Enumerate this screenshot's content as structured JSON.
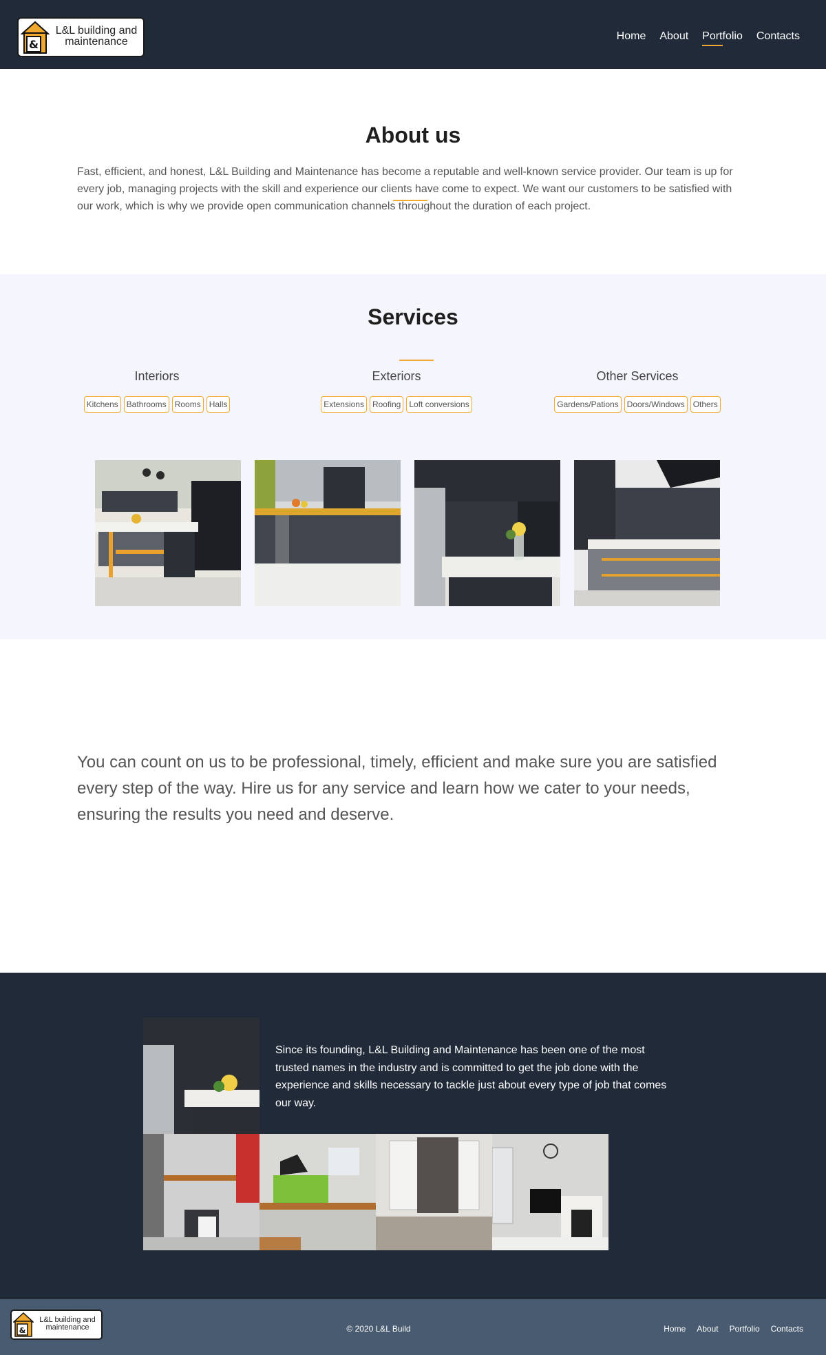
{
  "header": {
    "logo_line1": "L&L building and",
    "logo_line2": "maintenance",
    "nav": [
      "Home",
      "About",
      "Portfolio",
      "Contacts"
    ],
    "active_nav": "Portfolio"
  },
  "about": {
    "title": "About us",
    "text": "Fast, efficient, and honest, L&L Building and Maintenance has become a reputable and well-known service provider. Our team is up for every job, managing projects with the skill and experience our clients have come to expect. We want our customers to be satisfied with our work, which is why we provide open communication channels throughout the duration of each project."
  },
  "services": {
    "title": "Services",
    "columns": [
      {
        "heading": "Interiors",
        "tags": [
          "Kitchens",
          "Bathrooms",
          "Rooms",
          "Halls"
        ]
      },
      {
        "heading": "Exteriors",
        "tags": [
          "Extensions",
          "Roofing",
          "Loft conversions"
        ]
      },
      {
        "heading": "Other Services",
        "tags": [
          "Gardens/Pations",
          "Doors/Windows",
          "Others"
        ]
      }
    ]
  },
  "promise": "You can count on us to be professional, timely, efficient and make sure you are satisfied every step of the way. Hire us for any service and learn how we cater to your needs, ensuring the results you need and deserve.",
  "founding": "Since its founding, L&L Building and Maintenance has been one of the most trusted names in the industry and is committed to get the job done with the experience and skills necessary to tackle just about every type of job that comes our way.",
  "footer": {
    "copyright": "© 2020 L&L Build",
    "nav": [
      "Home",
      "About",
      "Portfolio",
      "Contacts"
    ]
  },
  "colors": {
    "header_bg": "#212a39",
    "accent": "#f0a92e",
    "services_bg": "#f5f6fd",
    "bottombar_bg": "#485b70"
  }
}
